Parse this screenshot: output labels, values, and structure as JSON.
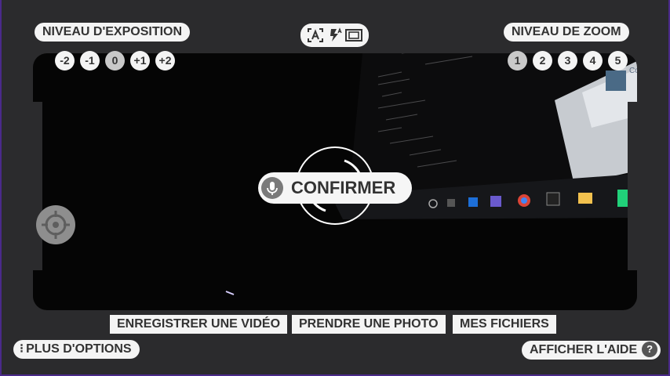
{
  "exposure": {
    "label": "NIVEAU D'EXPOSITION",
    "levels": [
      "-2",
      "-1",
      "0",
      "+1",
      "+2"
    ],
    "selected": "0"
  },
  "zoom": {
    "label": "NIVEAU DE ZOOM",
    "levels": [
      "1",
      "2",
      "3",
      "4",
      "5"
    ],
    "selected": "1"
  },
  "mode_icons": [
    "auto-focus-icon",
    "flash-auto-icon",
    "aspect-ratio-icon"
  ],
  "center": {
    "confirm_label": "CONFIRMER",
    "mic_icon": "microphone-icon"
  },
  "actions": {
    "record_video": "ENREGISTRER UNE VIDÉO",
    "take_photo": "PRENDRE UNE PHOTO",
    "my_files": "MES FICHIERS"
  },
  "more_options": "PLUS D'OPTIONS",
  "more_options_icon": "⁝",
  "help": {
    "label": "AFFICHER L'AIDE",
    "icon_glyph": "?"
  },
  "preview": {
    "window_text": "Co\nRé A"
  },
  "colors": {
    "background": "#2b2b2d",
    "pill": "#f4f4f4",
    "pill_text": "#333333",
    "selected_circle": "#c9c9c9",
    "edge_accent": "#4a2a8a"
  }
}
